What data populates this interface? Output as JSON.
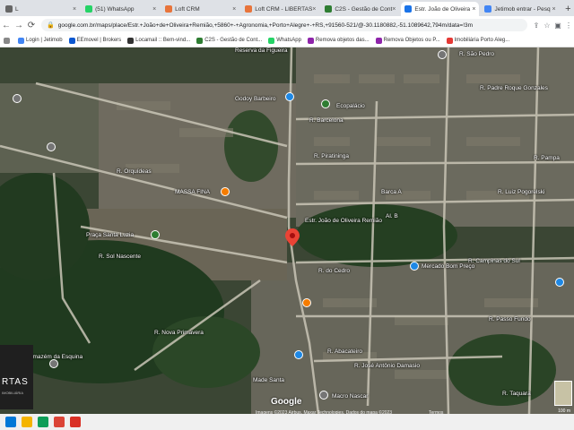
{
  "tabs": [
    {
      "label": "L",
      "color": "#666"
    },
    {
      "label": "(51) WhatsApp",
      "color": "#25d366"
    },
    {
      "label": "Loft CRM",
      "color": "#e8743b"
    },
    {
      "label": "Loft CRM - LIBERTAS",
      "color": "#e8743b"
    },
    {
      "label": "C2S - Gestão de Cont",
      "color": "#2e7d32"
    },
    {
      "label": "Estr. João de Oliveira",
      "color": "#1a73e8",
      "active": true
    },
    {
      "label": "Jetimob entrar - Pesq",
      "color": "#4285f4"
    }
  ],
  "url": "google.com.br/maps/place/Estr.+João+de+Oliveira+Remião,+5860+-+Agronomia,+Porto+Alegre+-+RS,+91560-521/@-30.1180882,-51.1089642,794m/data=!3m",
  "bookmarks": [
    {
      "label": "Login | Jetimob",
      "color": "#4285f4"
    },
    {
      "label": "EEmovel | Brokers",
      "color": "#0b57d0"
    },
    {
      "label": "Locamail :: Bem-vind...",
      "color": "#333"
    },
    {
      "label": "C2S - Gestão de Cont...",
      "color": "#2e7d32"
    },
    {
      "label": "WhatsApp",
      "color": "#25d366"
    },
    {
      "label": "Remova objetos das...",
      "color": "#8e24aa"
    },
    {
      "label": "Remova Objetos ou P...",
      "color": "#8e24aa"
    },
    {
      "label": "Imobiliária Porto Aleg...",
      "color": "#e53935"
    }
  ],
  "map_labels": [
    "Reserva da Figueira",
    "R. São Pedro",
    "R. Padre Roque Gonzales",
    "Godoy Barbeiro",
    "R. Barcelona",
    "Ecopalácio",
    "R. Piratininga",
    "R. Luiz Pogorelski",
    "R. Orquídeas",
    "MASSA FINA",
    "Mercado Bom Preço",
    "R. Campinas do Sul",
    "R. Sol Nascente",
    "Praça Santa Luzia",
    "R. Nova Primavera",
    "R. do Cedro",
    "R. Abacateiro",
    "R. Passo Fundo",
    "R. José Antônio Damasio",
    "Made Santa",
    "Macro Nascar",
    "Armazém da Esquina",
    "Estr. João de Oliveira Remião",
    "R. Taquara",
    "Barca A",
    "Al. B",
    "R. Pampa"
  ],
  "overlay": {
    "logo_big": "RTAS",
    "logo_small": "IMOBILIÁRIA"
  },
  "footer": {
    "brand": "Google",
    "copyright": "Imagens ©2023 Airbus, Maxar Technologies, Dados do mapa ©2023",
    "terms": "Termos",
    "scale": "100 m"
  }
}
